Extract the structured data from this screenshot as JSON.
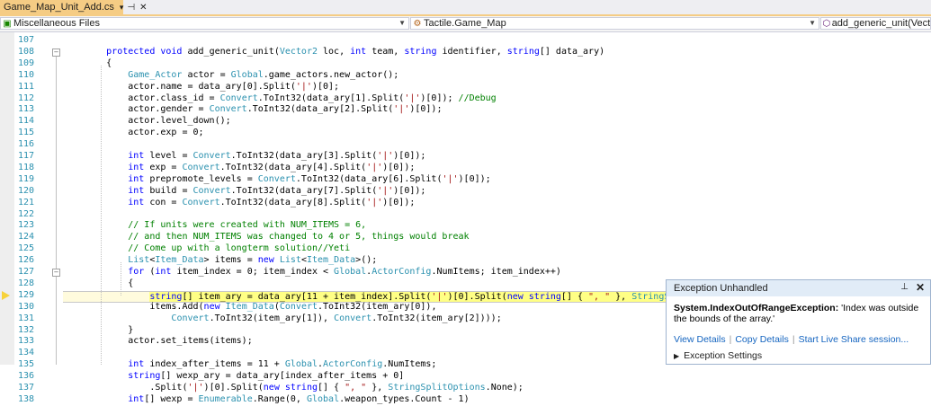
{
  "tab": {
    "label": "Game_Map_Unit_Add.cs"
  },
  "nav": {
    "project": "Miscellaneous Files",
    "type": "Tactile.Game_Map",
    "member": "add_generic_unit(Vector2 l"
  },
  "line_numbers": [
    "107",
    "108",
    "109",
    "110",
    "111",
    "112",
    "113",
    "114",
    "115",
    "116",
    "117",
    "118",
    "119",
    "120",
    "121",
    "122",
    "123",
    "124",
    "125",
    "126",
    "127",
    "128",
    "129",
    "130",
    "131",
    "132",
    "133",
    "134",
    "135",
    "136",
    "137",
    "138"
  ],
  "code_lines": [
    [],
    [
      [
        "kw",
        "        protected void "
      ],
      [
        "plain",
        "add_generic_unit("
      ],
      [
        "ty",
        "Vector2"
      ],
      [
        "plain",
        " loc, "
      ],
      [
        "kw",
        "int"
      ],
      [
        "plain",
        " team, "
      ],
      [
        "kw",
        "string"
      ],
      [
        "plain",
        " identifier, "
      ],
      [
        "kw",
        "string"
      ],
      [
        "plain",
        "[] data_ary)"
      ]
    ],
    [
      [
        "plain",
        "        {"
      ]
    ],
    [
      [
        "ty",
        "            Game_Actor"
      ],
      [
        "plain",
        " actor = "
      ],
      [
        "ty",
        "Global"
      ],
      [
        "plain",
        ".game_actors.new_actor();"
      ]
    ],
    [
      [
        "plain",
        "            actor.name = data_ary[0].Split("
      ],
      [
        "str",
        "'|'"
      ],
      [
        "plain",
        ")[0];"
      ]
    ],
    [
      [
        "plain",
        "            actor.class_id = "
      ],
      [
        "ty",
        "Convert"
      ],
      [
        "plain",
        ".ToInt32(data_ary[1].Split("
      ],
      [
        "str",
        "'|'"
      ],
      [
        "plain",
        ")[0]); "
      ],
      [
        "cm",
        "//Debug"
      ]
    ],
    [
      [
        "plain",
        "            actor.gender = "
      ],
      [
        "ty",
        "Convert"
      ],
      [
        "plain",
        ".ToInt32(data_ary[2].Split("
      ],
      [
        "str",
        "'|'"
      ],
      [
        "plain",
        ")[0]);"
      ]
    ],
    [
      [
        "plain",
        "            actor.level_down();"
      ]
    ],
    [
      [
        "plain",
        "            actor.exp = 0;"
      ]
    ],
    [],
    [
      [
        "kw",
        "            int"
      ],
      [
        "plain",
        " level = "
      ],
      [
        "ty",
        "Convert"
      ],
      [
        "plain",
        ".ToInt32(data_ary[3].Split("
      ],
      [
        "str",
        "'|'"
      ],
      [
        "plain",
        ")[0]);"
      ]
    ],
    [
      [
        "kw",
        "            int"
      ],
      [
        "plain",
        " exp = "
      ],
      [
        "ty",
        "Convert"
      ],
      [
        "plain",
        ".ToInt32(data_ary[4].Split("
      ],
      [
        "str",
        "'|'"
      ],
      [
        "plain",
        ")[0]);"
      ]
    ],
    [
      [
        "kw",
        "            int"
      ],
      [
        "plain",
        " prepromote_levels = "
      ],
      [
        "ty",
        "Convert"
      ],
      [
        "plain",
        ".ToInt32(data_ary[6].Split("
      ],
      [
        "str",
        "'|'"
      ],
      [
        "plain",
        ")[0]);"
      ]
    ],
    [
      [
        "kw",
        "            int"
      ],
      [
        "plain",
        " build = "
      ],
      [
        "ty",
        "Convert"
      ],
      [
        "plain",
        ".ToInt32(data_ary[7].Split("
      ],
      [
        "str",
        "'|'"
      ],
      [
        "plain",
        ")[0]);"
      ]
    ],
    [
      [
        "kw",
        "            int"
      ],
      [
        "plain",
        " con = "
      ],
      [
        "ty",
        "Convert"
      ],
      [
        "plain",
        ".ToInt32(data_ary[8].Split("
      ],
      [
        "str",
        "'|'"
      ],
      [
        "plain",
        ")[0]);"
      ]
    ],
    [],
    [
      [
        "cm",
        "            // If units were created with NUM_ITEMS = 6,"
      ]
    ],
    [
      [
        "cm",
        "            // and then NUM_ITEMS was changed to 4 or 5, things would break"
      ]
    ],
    [
      [
        "cm",
        "            // Come up with a longterm solution//Yeti"
      ]
    ],
    [
      [
        "ty",
        "            List"
      ],
      [
        "plain",
        "<"
      ],
      [
        "ty",
        "Item_Data"
      ],
      [
        "plain",
        "> items = "
      ],
      [
        "kw",
        "new "
      ],
      [
        "ty",
        "List"
      ],
      [
        "plain",
        "<"
      ],
      [
        "ty",
        "Item_Data"
      ],
      [
        "plain",
        ">();"
      ]
    ],
    [
      [
        "kw",
        "            for"
      ],
      [
        "plain",
        " ("
      ],
      [
        "kw",
        "int"
      ],
      [
        "plain",
        " item_index = 0; item_index < "
      ],
      [
        "ty",
        "Global"
      ],
      [
        "plain",
        "."
      ],
      [
        "ty",
        "ActorConfig"
      ],
      [
        "plain",
        ".NumItems; item_index++)"
      ]
    ],
    [
      [
        "plain",
        "            {"
      ]
    ],
    [
      [
        "plain",
        "                "
      ],
      [
        "kw",
        "string"
      ],
      [
        "plain",
        "[] item_ary = data_ary[11 + item_index].Split("
      ],
      [
        "str",
        "'|'"
      ],
      [
        "plain",
        ")[0].Split("
      ],
      [
        "kw",
        "new string"
      ],
      [
        "plain",
        "[] { "
      ],
      [
        "str",
        "\", \""
      ],
      [
        "plain",
        " }, "
      ],
      [
        "ty",
        "StringSplitOptions"
      ],
      [
        "plain",
        ".None);"
      ]
    ],
    [
      [
        "plain",
        "                items.Add("
      ],
      [
        "kw",
        "new "
      ],
      [
        "ty",
        "Item_Data"
      ],
      [
        "plain",
        "("
      ],
      [
        "ty",
        "Convert"
      ],
      [
        "plain",
        ".ToInt32(item_ary[0]),"
      ]
    ],
    [
      [
        "plain",
        "                    "
      ],
      [
        "ty",
        "Convert"
      ],
      [
        "plain",
        ".ToInt32(item_ary[1]), "
      ],
      [
        "ty",
        "Convert"
      ],
      [
        "plain",
        ".ToInt32(item_ary[2])));"
      ]
    ],
    [
      [
        "plain",
        "            }"
      ]
    ],
    [
      [
        "plain",
        "            actor.set_items(items);"
      ]
    ],
    [],
    [
      [
        "kw",
        "            int"
      ],
      [
        "plain",
        " index_after_items = 11 + "
      ],
      [
        "ty",
        "Global"
      ],
      [
        "plain",
        "."
      ],
      [
        "ty",
        "ActorConfig"
      ],
      [
        "plain",
        ".NumItems;"
      ]
    ],
    [
      [
        "kw",
        "            string"
      ],
      [
        "plain",
        "[] wexp_ary = data_ary[index_after_items + 0]"
      ]
    ],
    [
      [
        "plain",
        "                .Split("
      ],
      [
        "str",
        "'|'"
      ],
      [
        "plain",
        ")[0].Split("
      ],
      [
        "kw",
        "new string"
      ],
      [
        "plain",
        "[] { "
      ],
      [
        "str",
        "\", \""
      ],
      [
        "plain",
        " }, "
      ],
      [
        "ty",
        "StringSplitOptions"
      ],
      [
        "plain",
        ".None);"
      ]
    ],
    [
      [
        "kw",
        "            int"
      ],
      [
        "plain",
        "[] wexp = "
      ],
      [
        "ty",
        "Enumerable"
      ],
      [
        "plain",
        ".Range(0, "
      ],
      [
        "ty",
        "Global"
      ],
      [
        "plain",
        ".weapon_types.Count - 1)"
      ]
    ]
  ],
  "current_line": "129",
  "exception": {
    "title": "Exception Unhandled",
    "type": "System.IndexOutOfRangeException:",
    "message": " 'Index was outside the bounds of the array.'",
    "links": [
      "View Details",
      "Copy Details",
      "Start Live Share session..."
    ],
    "settings": "Exception Settings"
  },
  "icons": {
    "tab_dropdown": "chevron-down-icon",
    "tab_pin": "pin-icon",
    "tab_close": "close-icon",
    "project": "csharp-file-icon",
    "type": "class-icon",
    "member": "method-icon",
    "breakpoint_arrow": "current-statement-arrow-icon",
    "error": "error-icon"
  },
  "colors": {
    "tab_active": "#f5cc84",
    "keyword": "#0000ff",
    "type": "#2b91af",
    "string": "#a31515",
    "comment": "#008000",
    "current_statement": "#ffff85",
    "error": "#e51400",
    "link": "#1565c0"
  }
}
